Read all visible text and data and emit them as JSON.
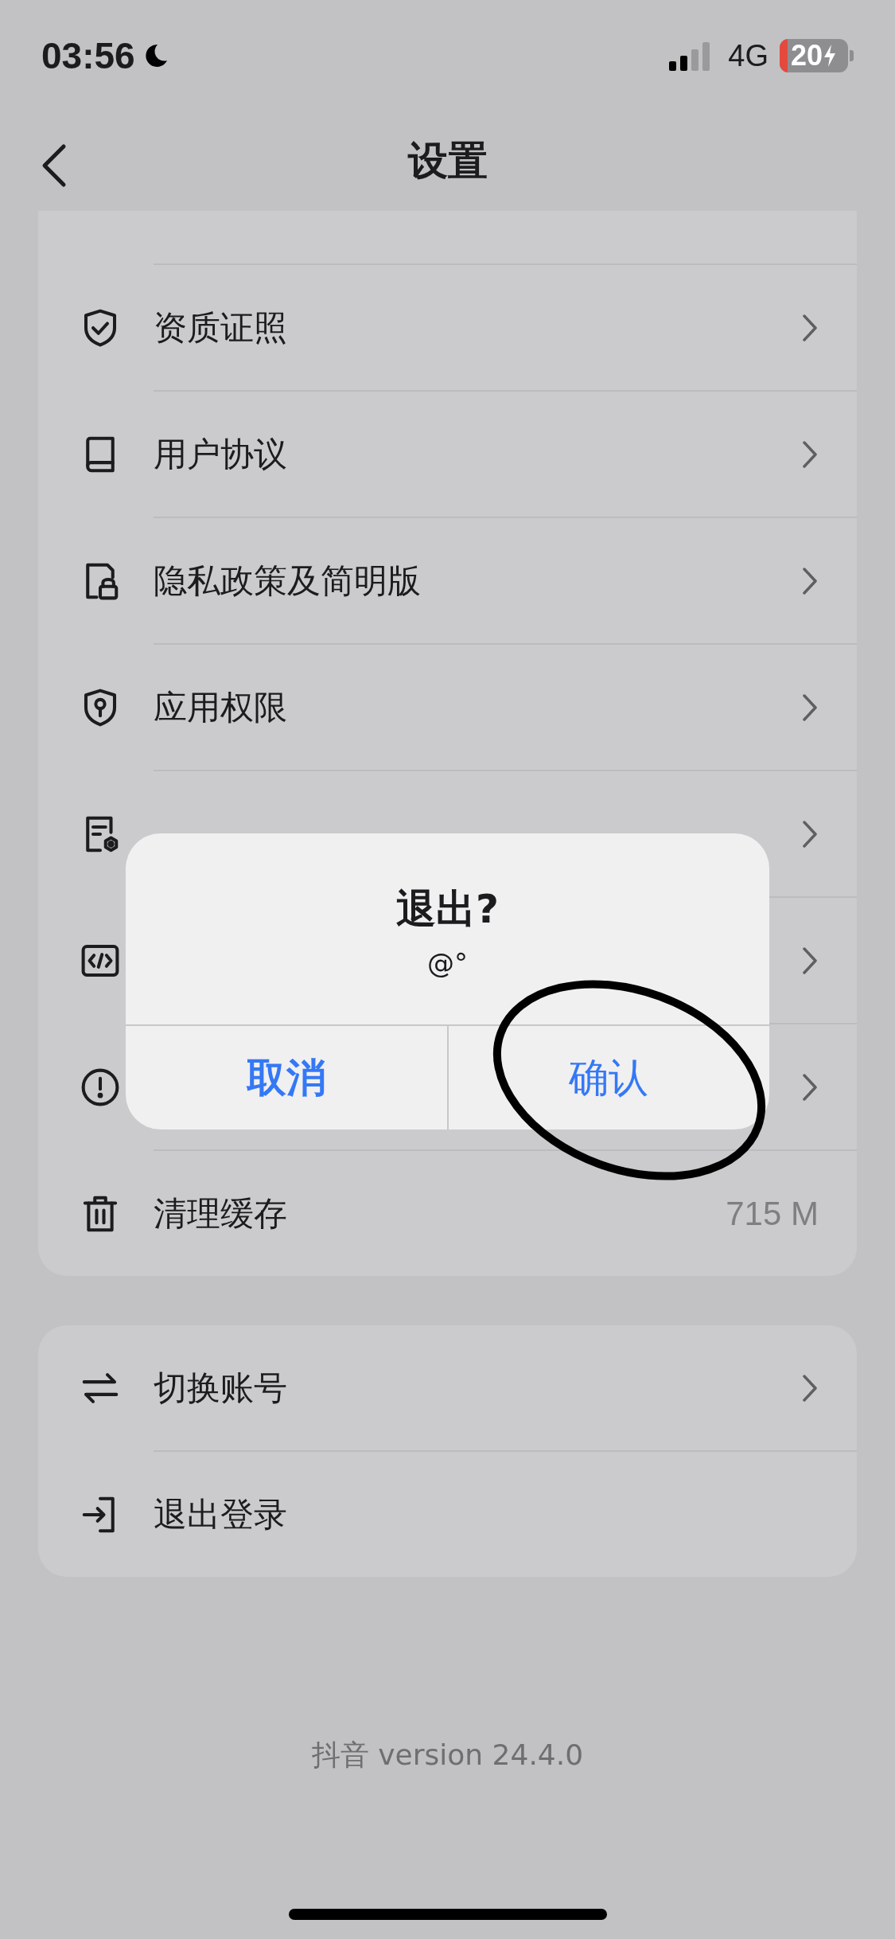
{
  "status_bar": {
    "time": "03:56",
    "network": "4G",
    "battery": "20"
  },
  "header": {
    "title": "设置"
  },
  "settings_group": [
    {
      "kind": "link",
      "label": "资质证照"
    },
    {
      "kind": "link",
      "label": "用户协议"
    },
    {
      "kind": "link",
      "label": "隐私政策及简明版"
    },
    {
      "kind": "link",
      "label": "应用权限"
    },
    {
      "kind": "link"
    },
    {
      "kind": "link"
    },
    {
      "kind": "link"
    },
    {
      "kind": "value",
      "label": "清理缓存",
      "value": "715 M"
    }
  ],
  "account_group": [
    {
      "kind": "link",
      "label": "切换账号"
    },
    {
      "kind": "plain",
      "label": "退出登录"
    }
  ],
  "footer": {
    "version": "抖音 version 24.4.0"
  },
  "dialog": {
    "title": "退出?",
    "message": "@°",
    "buttons": [
      {
        "kind": "cancel",
        "label": "取消"
      },
      {
        "kind": "confirm",
        "label": "确认"
      }
    ]
  }
}
